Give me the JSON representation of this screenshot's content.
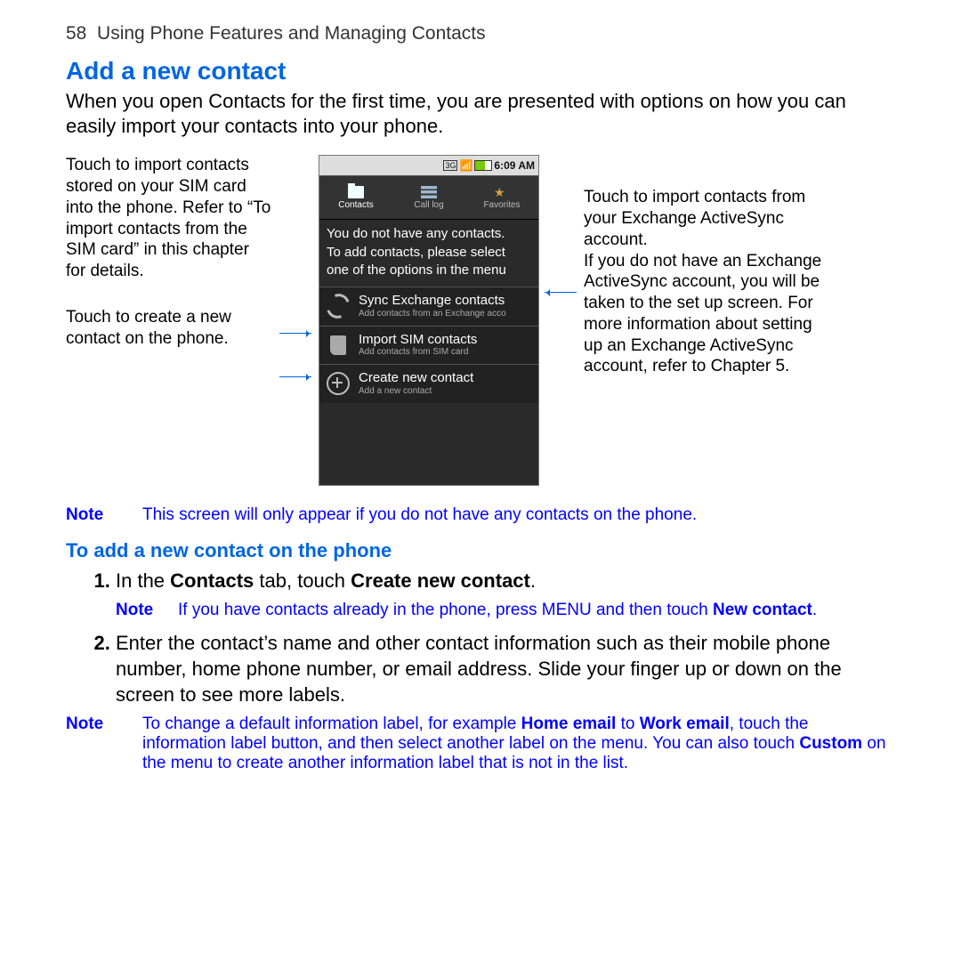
{
  "header": {
    "page_num": "58",
    "chapter": "Using Phone Features and Managing Contacts"
  },
  "section": {
    "title": "Add a new contact",
    "intro": "When you open Contacts for the first time, you are presented with options on how you can easily import your contacts into your phone."
  },
  "callouts": {
    "sim": "Touch to import contacts stored on your SIM card into the phone. Refer to “To import contacts from the SIM card” in this chapter for details.",
    "create": "Touch to create a new contact on the phone.",
    "exchange": "Touch to import contacts from your Exchange ActiveSync account.\nIf you do not have an Exchange ActiveSync account, you will be taken to the set up screen. For more information about setting up an Exchange ActiveSync account, refer to Chapter 5."
  },
  "phone": {
    "time": "6:09 AM",
    "status_icons": [
      "3g-icon",
      "signal-icon",
      "battery-icon"
    ],
    "tabs": [
      {
        "label": "Contacts",
        "icon": "folder-icon",
        "active": true
      },
      {
        "label": "Call log",
        "icon": "list-icon",
        "active": false
      },
      {
        "label": "Favorites",
        "icon": "star-icon",
        "active": false
      }
    ],
    "empty_msg_l1": "You do not have any contacts.",
    "empty_msg_l2": "To add contacts, please select one of the options in the menu",
    "options": [
      {
        "title": "Sync Exchange contacts",
        "sub": "Add contacts from an Exchange acco",
        "icon": "sync-icon"
      },
      {
        "title": "Import SIM contacts",
        "sub": "Add contacts from SIM card",
        "icon": "sim-icon"
      },
      {
        "title": "Create new contact",
        "sub": "Add a new contact",
        "icon": "plus-icon"
      }
    ]
  },
  "note1": {
    "label": "Note",
    "text": "This screen will only appear if you do not have any contacts on the phone."
  },
  "subhead": "To add a new contact on the phone",
  "steps": {
    "s1_pre": "In the ",
    "s1_b1": "Contacts",
    "s1_mid": " tab, touch ",
    "s1_b2": "Create new contact",
    "s1_post": ".",
    "s1_note_label": "Note",
    "s1_note_text": "If you have contacts already in the phone, press MENU and then touch ",
    "s1_note_bold": "New contact",
    "s1_note_end": ".",
    "s2": "Enter the contact’s name and other contact information such as their mobile phone number, home phone number, or email address. Slide your finger up or down on the screen to see more labels."
  },
  "note2": {
    "label": "Note",
    "t1": "To change a default information label, for example ",
    "b1": "Home email",
    "t2": " to ",
    "b2": "Work email",
    "t3": ", touch the information label button, and then select another label on the menu. You can also touch ",
    "b3": "Custom",
    "t4": " on the menu to create another information label that is not in the list."
  }
}
